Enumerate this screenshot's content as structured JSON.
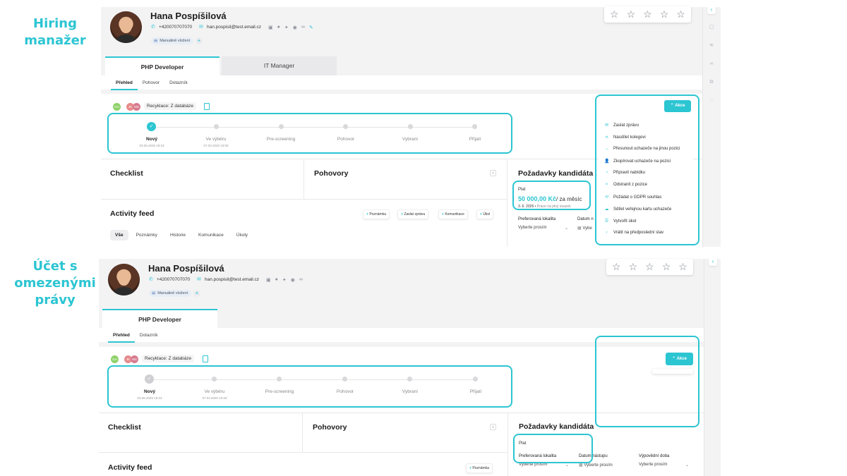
{
  "labels": {
    "hiring_manager": "Hiring manažer",
    "restricted_line1": "Účet s omezenými",
    "restricted_line2": "právy"
  },
  "candidate": {
    "name": "Hana Pospíšilová",
    "phone": "+420070707070",
    "email": "han.pospisil@test.email.cz",
    "tag": "Manuálně vložení",
    "socials": [
      "linkedin-icon",
      "facebook-icon",
      "twitter-icon",
      "skype-icon",
      "link-icon"
    ]
  },
  "rating": {
    "stars": 5,
    "filled": 0
  },
  "top": {
    "tabs": [
      {
        "label": "PHP Developer",
        "active": true
      },
      {
        "label": "IT Manager",
        "active": false
      }
    ],
    "subtabs": [
      "Přehled",
      "Pohovor",
      "Dotazník"
    ],
    "recycle": "Recyklace: Z databáze",
    "badges": [
      "GH",
      "JK",
      "MS"
    ],
    "steps": [
      {
        "label": "Nový",
        "date": "03.06.2025 19:23",
        "state": "active"
      },
      {
        "label": "Ve výběru",
        "date": "07.03.2020 10:00",
        "state": "todo"
      },
      {
        "label": "Pre-screening",
        "date": "",
        "state": "todo"
      },
      {
        "label": "Pohovor",
        "date": "",
        "state": "todo"
      },
      {
        "label": "Vybraní",
        "date": "",
        "state": "todo"
      },
      {
        "label": "Přijatí",
        "date": "",
        "state": "todo"
      }
    ],
    "checklist": "Checklist",
    "interviews": "Pohovory",
    "requirements": "Požadavky kandidáta",
    "activity": "Activity feed",
    "activity_buttons": [
      "Poznámka",
      "Zaslat zprávu",
      "Komunikace",
      "Úkol"
    ],
    "feed_tabs": [
      "Vše",
      "Poznámky",
      "Historie",
      "Komunikace",
      "Úkoly"
    ],
    "salary_label": "Plat",
    "salary_value": "50 000,00 Kč",
    "salary_unit": "/ za měsíc",
    "salary_date": "3. 6. 2025",
    "salary_note": "Práce na plný úvazek",
    "pref_location_label": "Preferovaná lokalita",
    "pref_location_value": "Vyberte prosím",
    "start_date_label": "Datum n",
    "start_date_value": "Vybe",
    "akce": "Akce",
    "menu": [
      {
        "icon": "mail-icon",
        "label": "Zaslat zprávu"
      },
      {
        "icon": "share-icon",
        "label": "Nasdílet kolegovi"
      },
      {
        "icon": "arrow-right-icon",
        "label": "Přesunout uchazeče na jinou pozici"
      },
      {
        "icon": "user-copy-icon",
        "label": "Zkopírovat uchazeče na pozici"
      },
      {
        "icon": "offer-icon",
        "label": "Připravit nabídku"
      },
      {
        "icon": "close-icon",
        "label": "Odstranit z pozice"
      },
      {
        "icon": "gdpr-icon",
        "label": "Požádat o GDPR souhlas"
      },
      {
        "icon": "card-icon",
        "label": "Sdílet veřejnou kartu uchazeče"
      },
      {
        "icon": "task-icon",
        "label": "Vytvořit úkol"
      },
      {
        "icon": "undo-icon",
        "label": "Vrátit na předposlední stav"
      }
    ]
  },
  "bottom": {
    "tabs": [
      {
        "label": "PHP Developer",
        "active": true
      }
    ],
    "subtabs": [
      "Přehled",
      "Dotazník"
    ],
    "recycle": "Recyklace: Z databáze",
    "badges": [
      "GH",
      "JK",
      "MS"
    ],
    "steps": [
      {
        "label": "Nový",
        "date": "03.06.2025 19:23",
        "state": "done"
      },
      {
        "label": "Ve výběru",
        "date": "07.03.2020 10:00",
        "state": "todo"
      },
      {
        "label": "Pre-screening",
        "date": "",
        "state": "todo"
      },
      {
        "label": "Pohovor",
        "date": "",
        "state": "todo"
      },
      {
        "label": "Vybraní",
        "date": "",
        "state": "todo"
      },
      {
        "label": "Přijatí",
        "date": "",
        "state": "todo"
      }
    ],
    "checklist": "Checklist",
    "interviews": "Pohovory",
    "requirements": "Požadavky kandidáta",
    "activity": "Activity feed",
    "activity_button": "Poznámka",
    "salary_label": "Plat",
    "pref_location_label": "Preferovaná lokalita",
    "pref_location_value": "Vyberte prosím",
    "start_date_label": "Datum nástupu",
    "start_date_value": "Vyberte prosím",
    "notice_label": "Výpovědní doba",
    "notice_value": "Vyberte prosím",
    "akce": "Akce"
  },
  "colors": {
    "accent": "#2cc5d2",
    "panel": "#f3f3f4"
  }
}
